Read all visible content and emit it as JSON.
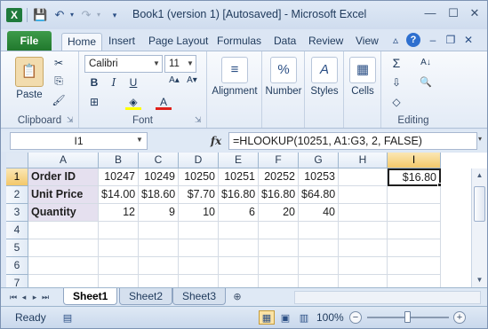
{
  "window": {
    "title": "Book1 (version 1) [Autosaved]  -  Microsoft Excel",
    "app_icon": "X",
    "controls": {
      "minimize": "—",
      "maximize": "☐",
      "close": "✕"
    }
  },
  "quick_access": {
    "save": "💾",
    "undo": "↶",
    "redo": "↷",
    "customize": "▾"
  },
  "ribbon_tabs": {
    "file": "File",
    "items": [
      "Home",
      "Insert",
      "Page Layout",
      "Formulas",
      "Data",
      "Review",
      "View"
    ],
    "active": "Home"
  },
  "ribbon": {
    "clipboard": {
      "paste": "Paste",
      "label": "Clipboard",
      "cut": "✂",
      "copy": "⎘",
      "painter": "🖌"
    },
    "font": {
      "name": "Calibri",
      "size": "11",
      "label": "Font",
      "bold": "B",
      "italic": "I",
      "underline": "U",
      "grow": "A▴",
      "shrink": "A▾",
      "borders": "⊞",
      "fill": "◈",
      "color": "A"
    },
    "alignment": {
      "label": "Alignment",
      "icon": "≡"
    },
    "number": {
      "label": "Number",
      "icon": "%"
    },
    "styles": {
      "label": "Styles",
      "icon": "A"
    },
    "cells": {
      "label": "Cells",
      "icon": "▦"
    },
    "editing": {
      "label": "Editing",
      "sum": "Σ",
      "fill": "⇩",
      "clear": "◇",
      "sort": "A↓",
      "find": "🔍"
    }
  },
  "formula_bar": {
    "name_box": "I1",
    "fx": "fx",
    "formula": "=HLOOKUP(10251, A1:G3, 2, FALSE)"
  },
  "grid": {
    "columns": [
      "A",
      "B",
      "C",
      "D",
      "E",
      "F",
      "G",
      "H",
      "I"
    ],
    "selected_column": "I",
    "rows": [
      "1",
      "2",
      "3",
      "4",
      "5",
      "6",
      "7"
    ],
    "selected_row": "1",
    "data": [
      [
        "Order ID",
        "10247",
        "10249",
        "10250",
        "10251",
        "20252",
        "10253",
        "",
        "$16.80"
      ],
      [
        "Unit Price",
        "$14.00",
        "$18.60",
        "$7.70",
        "$16.80",
        "$16.80",
        "$64.80",
        "",
        ""
      ],
      [
        "Quantity",
        "12",
        "9",
        "10",
        "6",
        "20",
        "40",
        "",
        ""
      ]
    ],
    "active_cell": "I1"
  },
  "sheets": {
    "tabs": [
      "Sheet1",
      "Sheet2",
      "Sheet3"
    ],
    "active": "Sheet1"
  },
  "status": {
    "ready": "Ready",
    "zoom": "100%",
    "zoom_level_percent": 100
  }
}
